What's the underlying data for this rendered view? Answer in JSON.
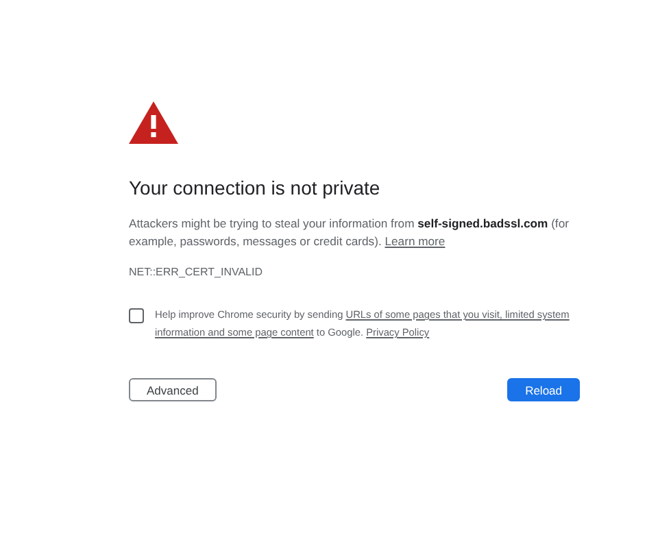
{
  "heading": "Your connection is not private",
  "message": {
    "before": "Attackers might be trying to steal your information from ",
    "host": "self-signed.badssl.com",
    "after": " (for example, passwords, messages or credit cards). ",
    "link": "Learn more"
  },
  "error_code": "NET::ERR_CERT_INVALID",
  "opt_in": {
    "checked": false,
    "parts": [
      {
        "kind": "text",
        "text": "Help improve Chrome security by sending "
      },
      {
        "kind": "link",
        "text": "URLs of some pages that you visit, limited system"
      },
      {
        "kind": "link",
        "text": "information and some page content"
      },
      {
        "kind": "text",
        "text": " to Google. "
      },
      {
        "kind": "link",
        "text": "Privacy Policy"
      }
    ]
  },
  "buttons": {
    "advanced": "Advanced",
    "reload": "Reload"
  }
}
